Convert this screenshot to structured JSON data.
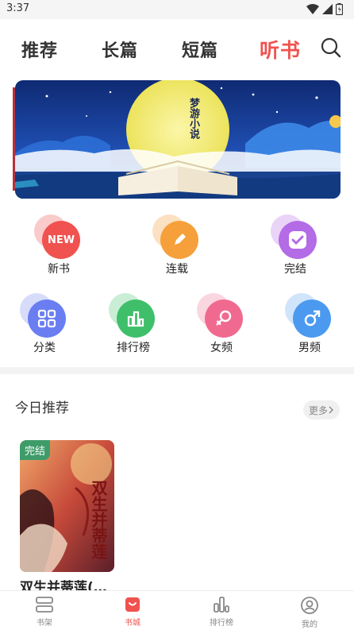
{
  "status_bar": {
    "time": "3:37"
  },
  "top_tabs": [
    {
      "label": "推荐",
      "active": false
    },
    {
      "label": "长篇",
      "active": false
    },
    {
      "label": "短篇",
      "active": false
    },
    {
      "label": "听书",
      "active": true
    }
  ],
  "banner": {
    "title": "梦游小说"
  },
  "features_row1": [
    {
      "label": "新书",
      "icon": "new-icon",
      "color": "#f0524f",
      "icon_text": "NEW"
    },
    {
      "label": "连载",
      "icon": "pencil-icon",
      "color": "#f5a03a"
    },
    {
      "label": "完结",
      "icon": "check-icon",
      "color": "#b46be6"
    }
  ],
  "features_row2": [
    {
      "label": "分类",
      "icon": "grid-icon",
      "color": "#6a7ef2"
    },
    {
      "label": "排行榜",
      "icon": "bar-chart-icon",
      "color": "#3fbf6a"
    },
    {
      "label": "女频",
      "icon": "female-icon",
      "color": "#f06a8f"
    },
    {
      "label": "男频",
      "icon": "male-icon",
      "color": "#4c9af0"
    }
  ],
  "today": {
    "title": "今日推荐",
    "more_label": "更多",
    "books": [
      {
        "title": "双生并蒂莲(…",
        "badge": "完结",
        "cover_text": "双生并蒂莲"
      }
    ]
  },
  "bottom_nav": [
    {
      "label": "书架",
      "icon": "bookshelf-icon",
      "active": false
    },
    {
      "label": "书城",
      "icon": "bookstore-icon",
      "active": true
    },
    {
      "label": "排行榜",
      "icon": "ranking-icon",
      "active": false
    },
    {
      "label": "我的",
      "icon": "profile-icon",
      "active": false
    }
  ],
  "colors": {
    "accent": "#f0524f",
    "text": "#333333"
  }
}
